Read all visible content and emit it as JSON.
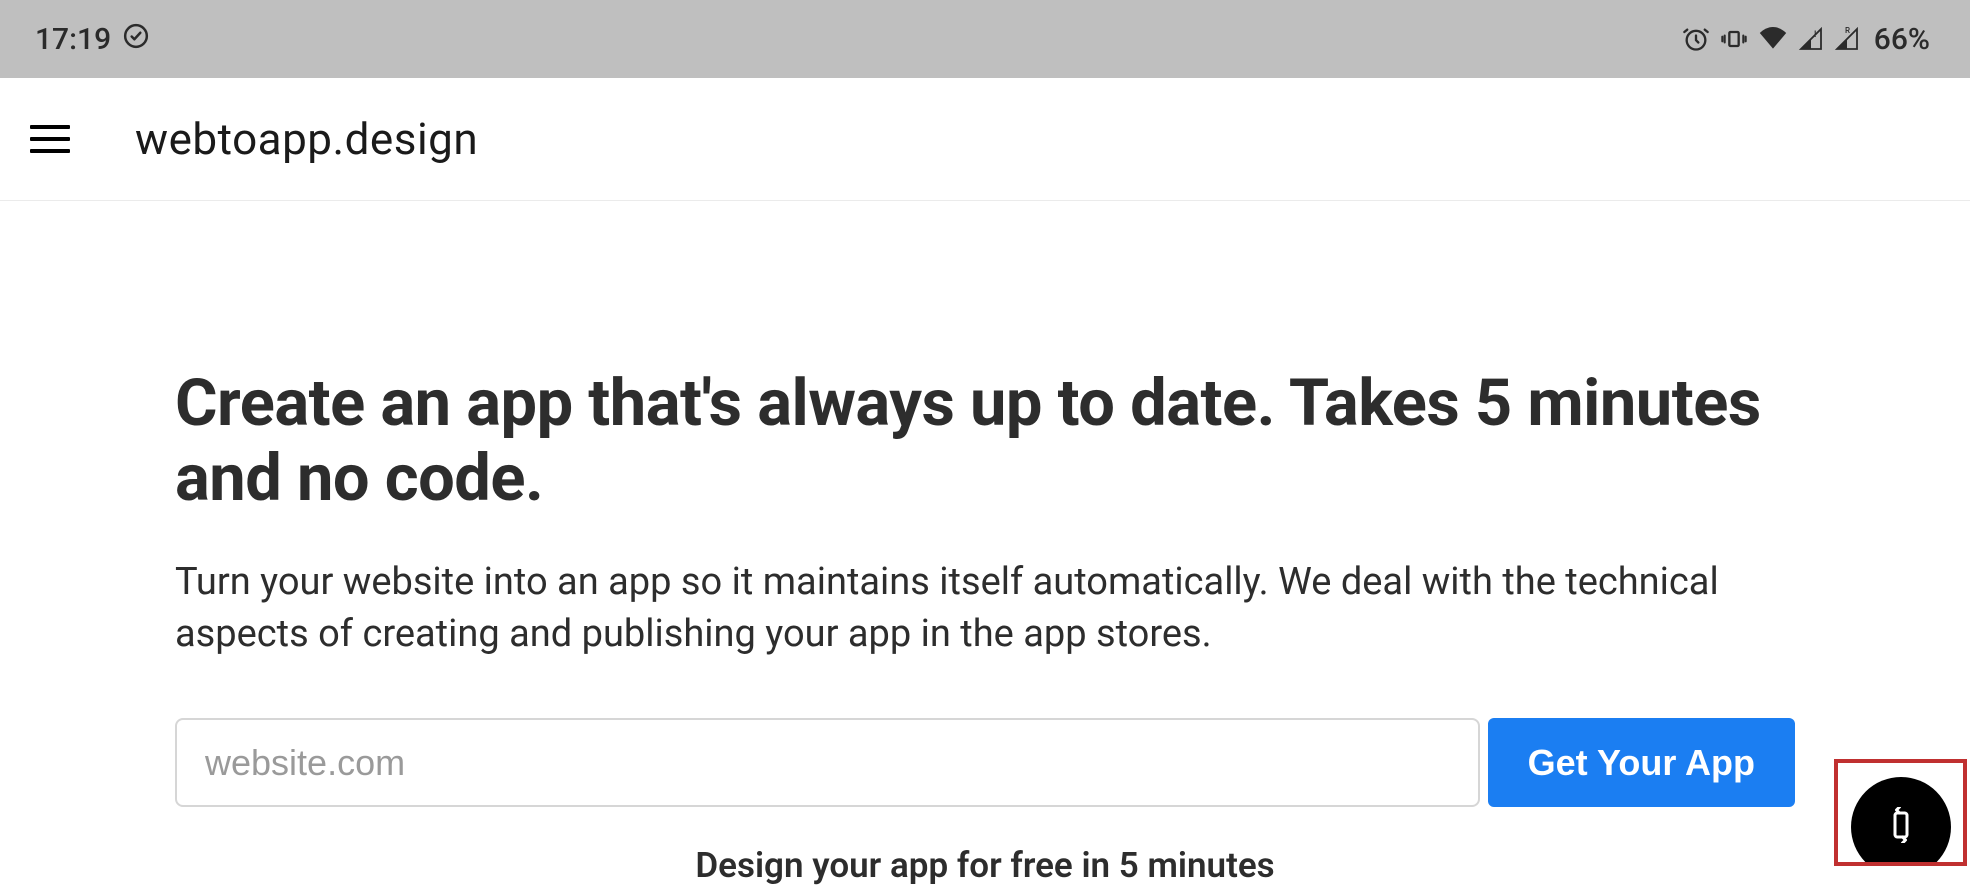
{
  "status_bar": {
    "time": "17:19",
    "battery_percent": "66%"
  },
  "app_bar": {
    "title": "webtoapp.design"
  },
  "hero": {
    "headline": "Create an app that's always up to date. Takes 5 minutes and no code.",
    "subtext": "Turn your website into an app so it maintains itself automatically. We deal with the technical aspects of creating and publishing your app in the app stores.",
    "input_placeholder": "website.com",
    "cta_label": "Get Your App",
    "footer_text": "Design your app for free in 5 minutes"
  }
}
